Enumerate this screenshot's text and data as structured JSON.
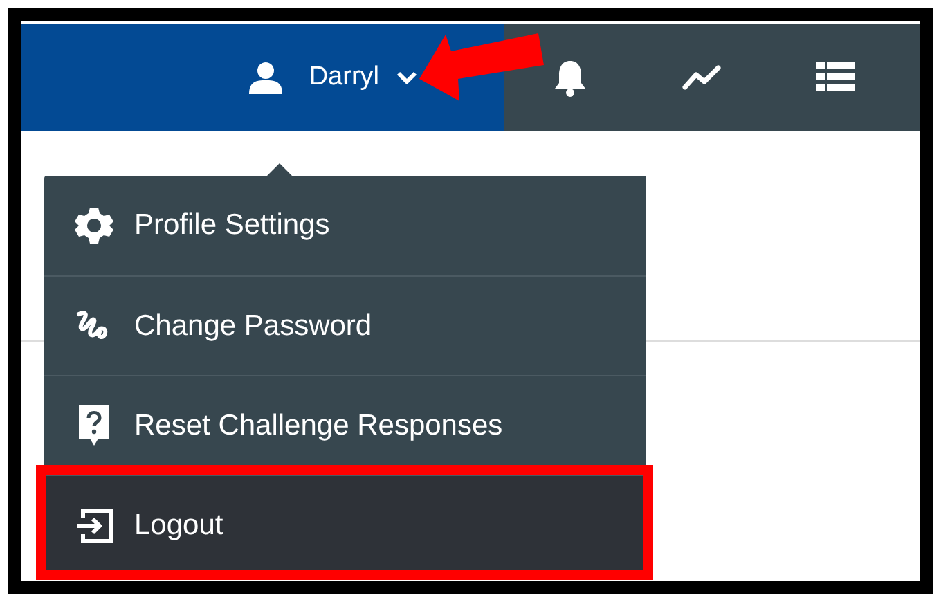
{
  "header": {
    "user_name": "Darryl",
    "nav_icons": [
      {
        "kind": "bell"
      },
      {
        "kind": "chart"
      },
      {
        "kind": "list"
      }
    ]
  },
  "menu": {
    "items": [
      {
        "label": "Profile Settings",
        "kind": "settings",
        "selected": false
      },
      {
        "label": "Change Password",
        "kind": "password",
        "selected": false
      },
      {
        "label": "Reset Challenge Responses",
        "kind": "question",
        "selected": false
      },
      {
        "label": "Logout",
        "kind": "logout",
        "selected": true
      }
    ]
  },
  "annotations": [
    {
      "kind": "arrow"
    },
    {
      "kind": "highlight_box"
    }
  ]
}
